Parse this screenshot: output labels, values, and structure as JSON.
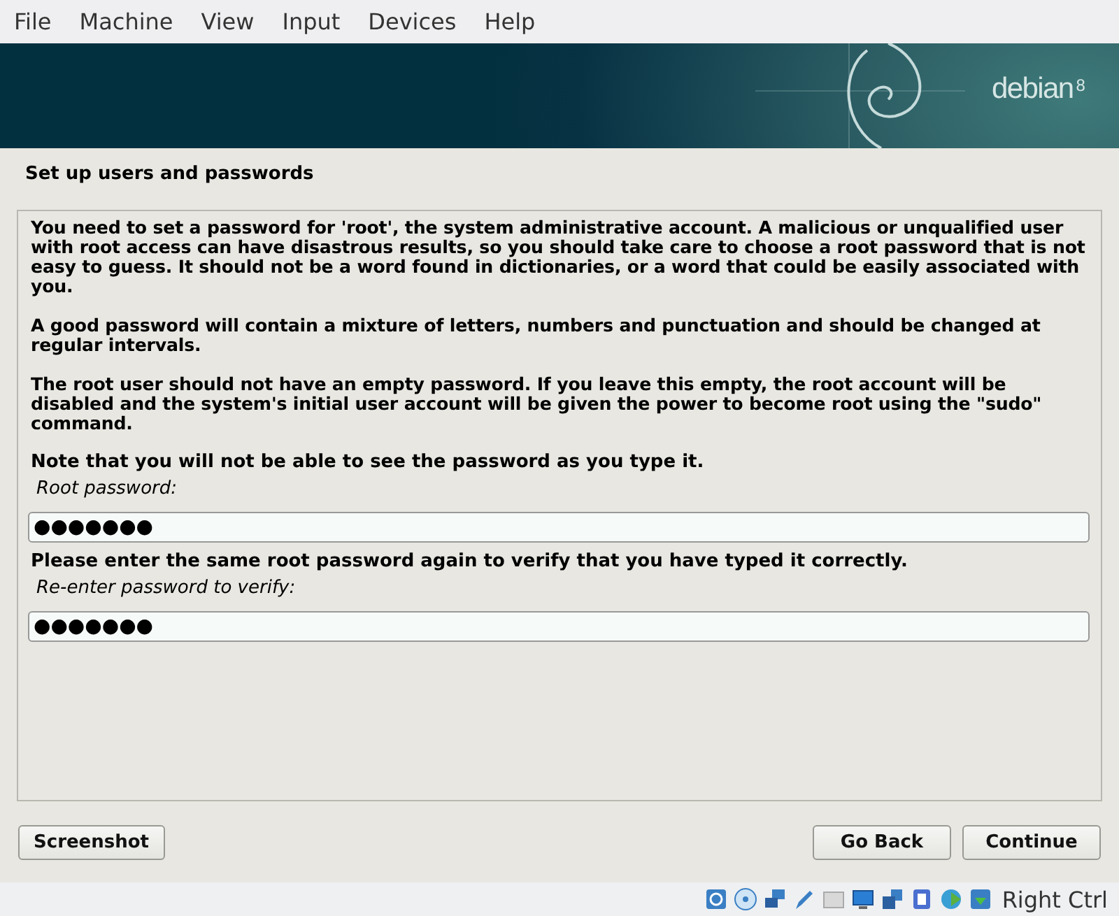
{
  "menu": [
    "File",
    "Machine",
    "View",
    "Input",
    "Devices",
    "Help"
  ],
  "banner": {
    "brand": "debian",
    "version": "8"
  },
  "title": "Set up users and passwords",
  "paragraphs": [
    "You need to set a password for 'root', the system administrative account. A malicious or unqualified user with root access can have disastrous results, so you should take care to choose a root password that is not easy to guess. It should not be a word found in dictionaries, or a word that could be easily associated with you.",
    "A good password will contain a mixture of letters, numbers and punctuation and should be changed at regular intervals.",
    "The root user should not have an empty password. If you leave this empty, the root account will be disabled and the system's initial user account will be given the power to become root using the \"sudo\" command."
  ],
  "fields": [
    {
      "prompt": "Note that you will not be able to see the password as you type it.",
      "label": "Root password:",
      "value": "●●●●●●●"
    },
    {
      "prompt": "Please enter the same root password again to verify that you have typed it correctly.",
      "label": "Re-enter password to verify:",
      "value": "●●●●●●●"
    }
  ],
  "buttons": {
    "left": "Screenshot",
    "back": "Go Back",
    "next": "Continue"
  },
  "status_bar": {
    "host_key": "Right Ctrl"
  }
}
